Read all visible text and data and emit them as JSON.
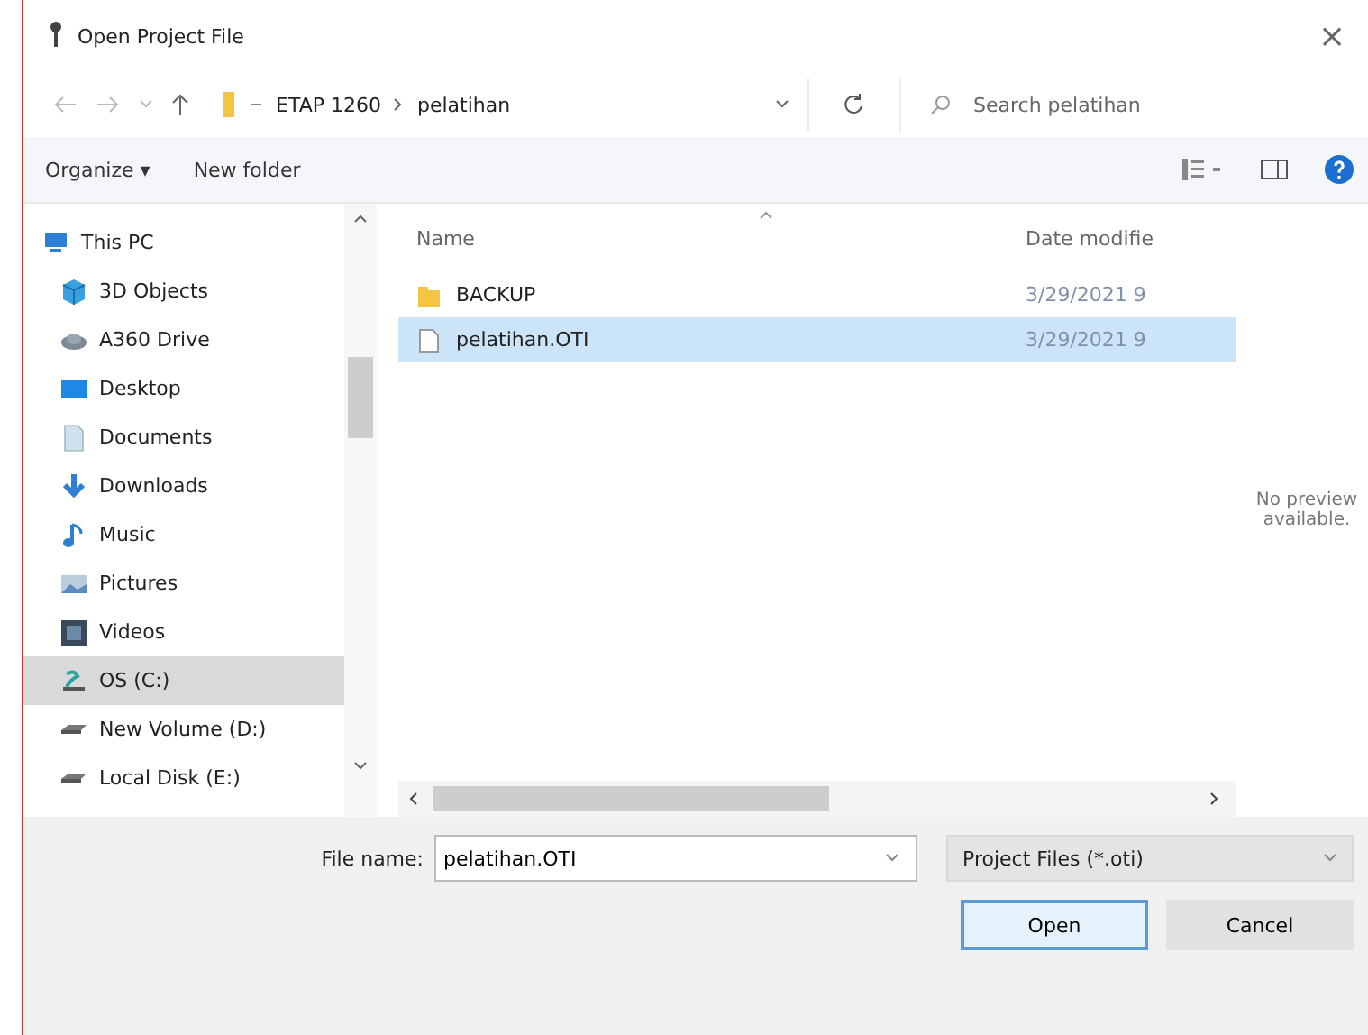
{
  "window": {
    "title": "Open Project File",
    "close": "×"
  },
  "address": {
    "path": [
      {
        "label": "ETAP 1260"
      },
      {
        "label": "pelatihan"
      }
    ],
    "search_placeholder": "Search pelatihan"
  },
  "toolbar": {
    "buttons": [
      {
        "label": "Organize ▾"
      },
      {
        "label": "New folder"
      }
    ]
  },
  "sidebar": {
    "items": [
      {
        "label": "This PC",
        "kind": "pc",
        "selected": false
      },
      {
        "label": "3D Objects",
        "kind": "objects",
        "selected": false
      },
      {
        "label": "A360 Drive",
        "kind": "cloud",
        "selected": false
      },
      {
        "label": "Desktop",
        "kind": "desktop",
        "selected": false
      },
      {
        "label": "Documents",
        "kind": "documents",
        "selected": false
      },
      {
        "label": "Downloads",
        "kind": "downloads",
        "selected": false
      },
      {
        "label": "Music",
        "kind": "music",
        "selected": false
      },
      {
        "label": "Pictures",
        "kind": "pictures",
        "selected": false
      },
      {
        "label": "Videos",
        "kind": "videos",
        "selected": false
      },
      {
        "label": "OS (C:)",
        "kind": "system",
        "selected": true
      },
      {
        "label": "New Volume (D:)",
        "kind": "drive",
        "selected": false
      },
      {
        "label": "Local Disk (E:)",
        "kind": "drive",
        "selected": false
      }
    ]
  },
  "table": {
    "columns": [
      "Name",
      "Date modifie"
    ],
    "rows": [
      {
        "name": "BACKUP",
        "date": "3/29/2021 9",
        "kind": "folder",
        "selected": false
      },
      {
        "name": "pelatihan.OTI",
        "date": "3/29/2021 9",
        "kind": "file",
        "selected": true
      }
    ]
  },
  "preview": {
    "message": "No preview available."
  },
  "footer": {
    "file_name_label": "File name:",
    "file_name": "pelatihan.OTI",
    "file_type": "Project Files (*.oti)",
    "buttons": [
      {
        "label": "Open",
        "kind": "default"
      },
      {
        "label": "Cancel",
        "kind": "normal"
      }
    ]
  }
}
